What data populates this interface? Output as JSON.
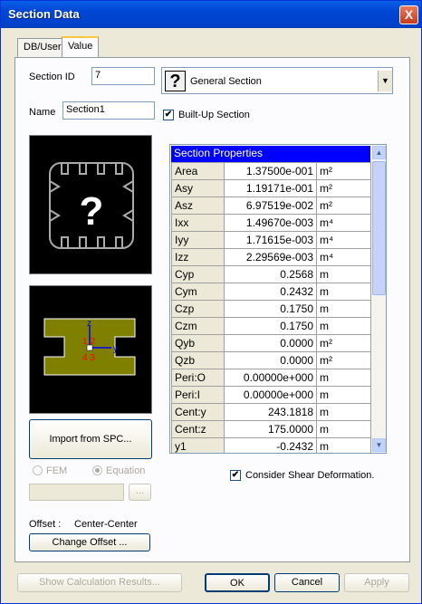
{
  "window": {
    "title": "Section Data",
    "close_label": "X"
  },
  "tabs": [
    {
      "label": "DB/User"
    },
    {
      "label": "Value"
    }
  ],
  "section_id": {
    "label": "Section ID",
    "value": "7"
  },
  "name": {
    "label": "Name",
    "value": "Section1"
  },
  "section_type": {
    "selected": "General Section",
    "icon": "?"
  },
  "built_up": {
    "label": "Built-Up Section",
    "checked": true
  },
  "preview": {
    "axis_z": "z",
    "axis_y": "y",
    "pt_labels_top": "1 2",
    "pt_labels_bot": "4 3",
    "color": "#808000"
  },
  "import_button": "Import from SPC...",
  "radio": {
    "fem": "FEM",
    "equation": "Equation",
    "selected": "Equation"
  },
  "browse_button": "...",
  "offset": {
    "label": "Offset :",
    "value": "Center-Center",
    "button": "Change Offset ..."
  },
  "grid": {
    "title": "Section Properties",
    "rows": [
      {
        "name": "Area",
        "value": "1.37500e-001",
        "unit": "m²"
      },
      {
        "name": "Asy",
        "value": "1.19171e-001",
        "unit": "m²"
      },
      {
        "name": "Asz",
        "value": "6.97519e-002",
        "unit": "m²"
      },
      {
        "name": "Ixx",
        "value": "1.49670e-003",
        "unit": "m⁴"
      },
      {
        "name": "Iyy",
        "value": "1.71615e-003",
        "unit": "m⁴"
      },
      {
        "name": "Izz",
        "value": "2.29569e-003",
        "unit": "m⁴"
      },
      {
        "name": "Cyp",
        "value": "0.2568",
        "unit": "m"
      },
      {
        "name": "Cym",
        "value": "0.2432",
        "unit": "m"
      },
      {
        "name": "Czp",
        "value": "0.1750",
        "unit": "m"
      },
      {
        "name": "Czm",
        "value": "0.1750",
        "unit": "m"
      },
      {
        "name": "Qyb",
        "value": "0.0000",
        "unit": "m²"
      },
      {
        "name": "Qzb",
        "value": "0.0000",
        "unit": "m²"
      },
      {
        "name": "Peri:O",
        "value": "0.00000e+000",
        "unit": "m"
      },
      {
        "name": "Peri:I",
        "value": "0.00000e+000",
        "unit": "m"
      },
      {
        "name": "Cent:y",
        "value": "243.1818",
        "unit": "m"
      },
      {
        "name": "Cent:z",
        "value": "175.0000",
        "unit": "m"
      },
      {
        "name": "y1",
        "value": "-0.2432",
        "unit": "m"
      }
    ]
  },
  "shear": {
    "label": "Consider Shear Deformation.",
    "checked": true
  },
  "footer": {
    "calc": "Show Calculation Results...",
    "ok": "OK",
    "cancel": "Cancel",
    "apply": "Apply"
  }
}
